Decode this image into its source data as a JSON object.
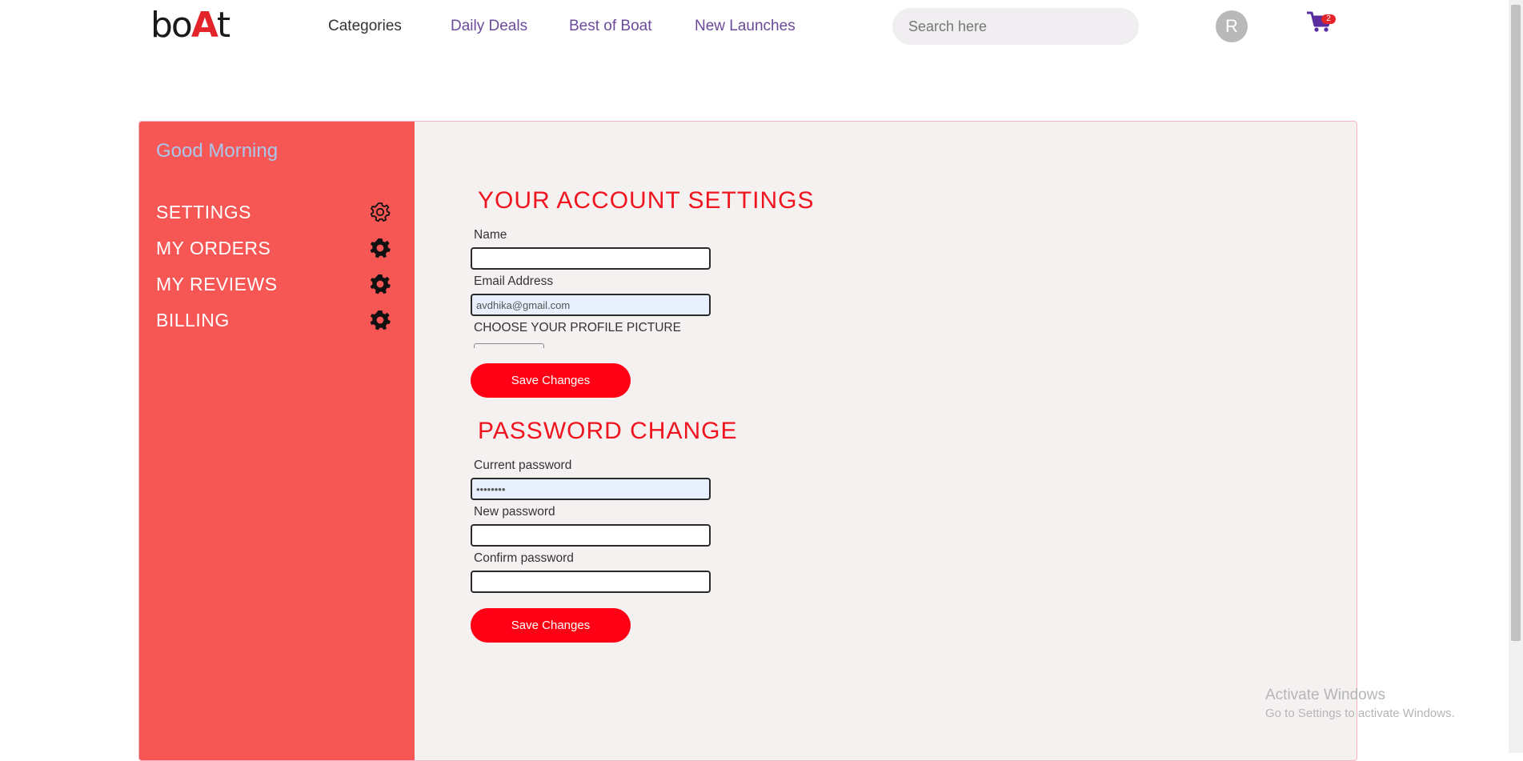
{
  "header": {
    "logo": {
      "prefix": "bo",
      "accent": "A",
      "suffix": "t"
    },
    "nav": {
      "categories": "Categories",
      "daily_deals": "Daily Deals",
      "best_of_boat": "Best of Boat",
      "new_launches": "New Launches"
    },
    "search": {
      "placeholder": "Search here",
      "value": ""
    },
    "avatar_initial": "R",
    "cart_count": "2"
  },
  "sidebar": {
    "greeting": "Good Morning",
    "items": [
      {
        "label": "SETTINGS",
        "icon": "gear-outline-icon"
      },
      {
        "label": "MY ORDERS",
        "icon": "gear-icon"
      },
      {
        "label": "MY REVIEWS",
        "icon": "gear-icon"
      },
      {
        "label": "BILLING",
        "icon": "gear-icon"
      }
    ]
  },
  "account_settings": {
    "title": "YOUR ACCOUNT SETTINGS",
    "name_label": "Name",
    "name_value": "",
    "email_label": "Email Address",
    "email_value": "avdhika@gmail.com",
    "picture_label": "CHOOSE YOUR PROFILE PICTURE",
    "save_label": "Save Changes"
  },
  "password_change": {
    "title": "PASSWORD CHANGE",
    "current_label": "Current password",
    "current_value": "********",
    "new_label": "New password",
    "new_value": "",
    "confirm_label": "Confirm password",
    "confirm_value": "",
    "save_label": "Save Changes"
  },
  "watermark": {
    "line1": "Activate Windows",
    "line2": "Go to Settings to activate Windows."
  },
  "colors": {
    "sidebar": "#f75754",
    "accent_red": "#ff0014",
    "title_red": "#f0141f",
    "nav_purple": "#6b4a9a",
    "greeting": "#a9c7ec",
    "content_bg": "#f6f1f1"
  }
}
